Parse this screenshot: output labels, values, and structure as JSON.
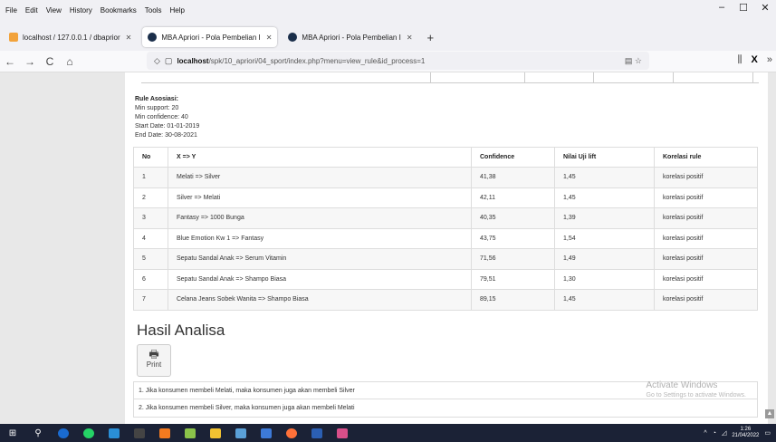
{
  "menu": [
    "File",
    "Edit",
    "View",
    "History",
    "Bookmarks",
    "Tools",
    "Help"
  ],
  "menu_underlines": [
    "F",
    "E",
    "V",
    "s",
    "B",
    "T",
    "H"
  ],
  "window_controls": [
    "–",
    "☐",
    "✕"
  ],
  "tabs": [
    {
      "title": "localhost / 127.0.0.1 / dbaprior",
      "icon": "phpmyadmin-icon",
      "active": false
    },
    {
      "title": "MBA Apriori - Pola Pembelian I",
      "icon": "site-icon",
      "active": true
    },
    {
      "title": "MBA Apriori - Pola Pembelian I",
      "icon": "site-icon",
      "active": false
    }
  ],
  "tab_close": "✕",
  "new_tab": "+",
  "nav": {
    "back": "←",
    "forward": "→",
    "reload": "C",
    "home": "⌂"
  },
  "url": {
    "host": "localhost",
    "path": "/spk/10_apriori/04_sport/index.php?menu=view_rule&id_process=1"
  },
  "rule": {
    "title": "Rule Asosiasi:",
    "min_support": "Min support: 20",
    "min_confidence": "Min confidence: 40",
    "start_date": "Start Date: 01-01-2019",
    "end_date": "End Date: 30-08-2021"
  },
  "table": {
    "headers": [
      "No",
      "X => Y",
      "Confidence",
      "Nilai Uji lift",
      "Korelasi rule"
    ],
    "rows": [
      [
        "1",
        "Melati => Silver",
        "41,38",
        "1,45",
        "korelasi positif"
      ],
      [
        "2",
        "Silver => Melati",
        "42,11",
        "1,45",
        "korelasi positif"
      ],
      [
        "3",
        "Fantasy => 1000 Bunga",
        "40,35",
        "1,39",
        "korelasi positif"
      ],
      [
        "4",
        "Blue Emotion Kw 1 => Fantasy",
        "43,75",
        "1,54",
        "korelasi positif"
      ],
      [
        "5",
        "Sepatu Sandal Anak => Serum Vitamin",
        "71,56",
        "1,49",
        "korelasi positif"
      ],
      [
        "6",
        "Sepatu Sandal Anak => Shampo Biasa",
        "79,51",
        "1,30",
        "korelasi positif"
      ],
      [
        "7",
        "Celana Jeans Sobek Wanita => Shampo Biasa",
        "89,15",
        "1,45",
        "korelasi positif"
      ]
    ]
  },
  "analysis": {
    "title": "Hasil Analisa",
    "print_label": "Print",
    "items": [
      "1. Jika konsumen membeli Melati, maka konsumen juga akan membeli Silver",
      "2. Jika konsumen membeli Silver, maka konsumen juga akan membeli Melati"
    ]
  },
  "watermark": {
    "title": "Activate Windows",
    "subtitle": "Go to Settings to activate Windows."
  },
  "taskbar": {
    "time": "1:26",
    "date": "21/04/2022"
  },
  "colors": {
    "taskbar": "#1b2236",
    "tab_icon": "#1a2e4a"
  }
}
